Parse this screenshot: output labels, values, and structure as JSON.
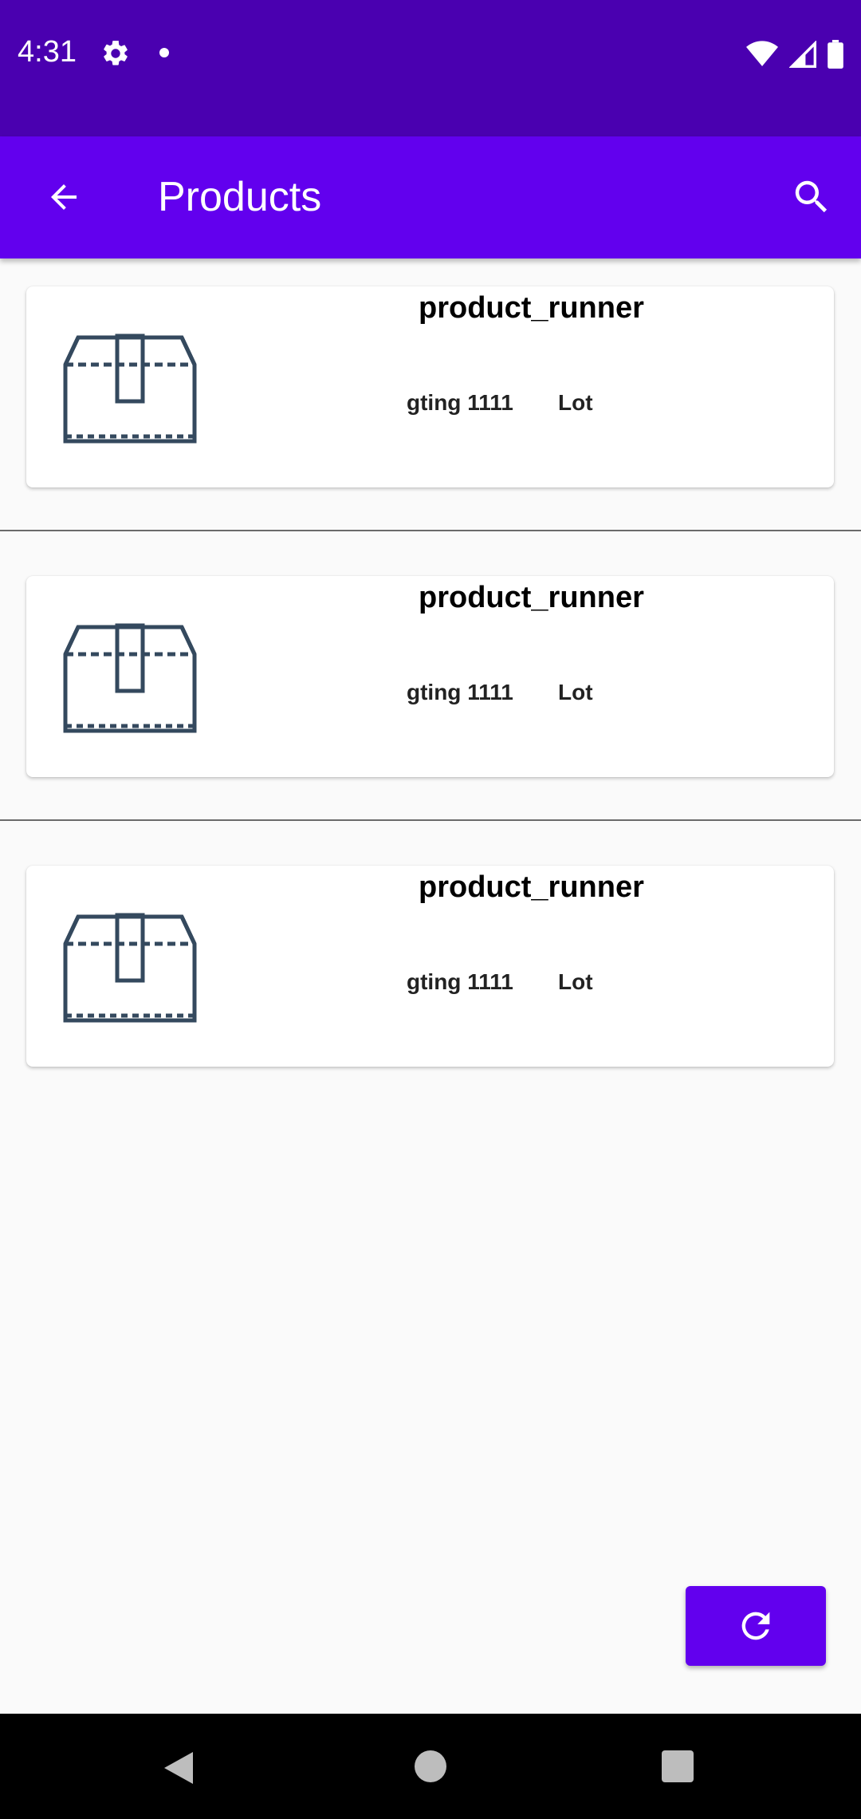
{
  "status_bar": {
    "time": "4:31",
    "icons": [
      "gear-icon",
      "notification-dot",
      "wifi-icon",
      "signal-icon",
      "battery-icon"
    ]
  },
  "app_bar": {
    "title": "Products",
    "back_icon": "arrow-back-icon",
    "search_icon": "search-icon"
  },
  "products": [
    {
      "name": "product_runner",
      "gtin": "gting 1111",
      "lot": "Lot",
      "icon": "box-icon"
    },
    {
      "name": "product_runner",
      "gtin": "gting 1111",
      "lot": "Lot",
      "icon": "box-icon"
    },
    {
      "name": "product_runner",
      "gtin": "gting 1111",
      "lot": "Lot",
      "icon": "box-icon"
    }
  ],
  "fab": {
    "icon": "refresh-icon"
  },
  "nav_bar": {
    "icons": [
      "nav-back-icon",
      "nav-home-icon",
      "nav-recents-icon"
    ]
  },
  "colors": {
    "status_bar": "#4a00b0",
    "app_bar": "#6200ee",
    "background": "#fafafa",
    "icon_stroke": "#34495e"
  }
}
